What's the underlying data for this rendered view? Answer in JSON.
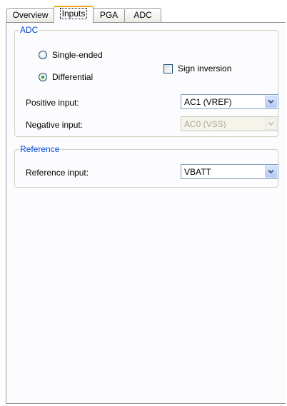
{
  "tabs": [
    {
      "label": "Overview",
      "active": false
    },
    {
      "label": "Inputs",
      "active": true
    },
    {
      "label": "PGA",
      "active": false
    },
    {
      "label": "ADC",
      "active": false
    }
  ],
  "adc_group": {
    "title": "ADC",
    "mode_options": [
      {
        "label": "Single-ended",
        "checked": false
      },
      {
        "label": "Differential",
        "checked": true
      }
    ],
    "sign_inversion": {
      "label": "Sign inversion",
      "checked": false
    },
    "positive_input": {
      "label": "Positive input:",
      "value": "AC1 (VREF)",
      "enabled": true
    },
    "negative_input": {
      "label": "Negative input:",
      "value": "AC0 (VSS)",
      "enabled": false
    }
  },
  "reference_group": {
    "title": "Reference",
    "reference_input": {
      "label": "Reference input:",
      "value": "VBATT",
      "enabled": true
    }
  },
  "icons": {
    "dropdown_arrow": "chevron-down-icon",
    "radio_selected_color": "#21a121"
  },
  "colors": {
    "group_title": "#0046d5",
    "active_tab_accent": "#f3a81d",
    "border": "#919b9c"
  }
}
